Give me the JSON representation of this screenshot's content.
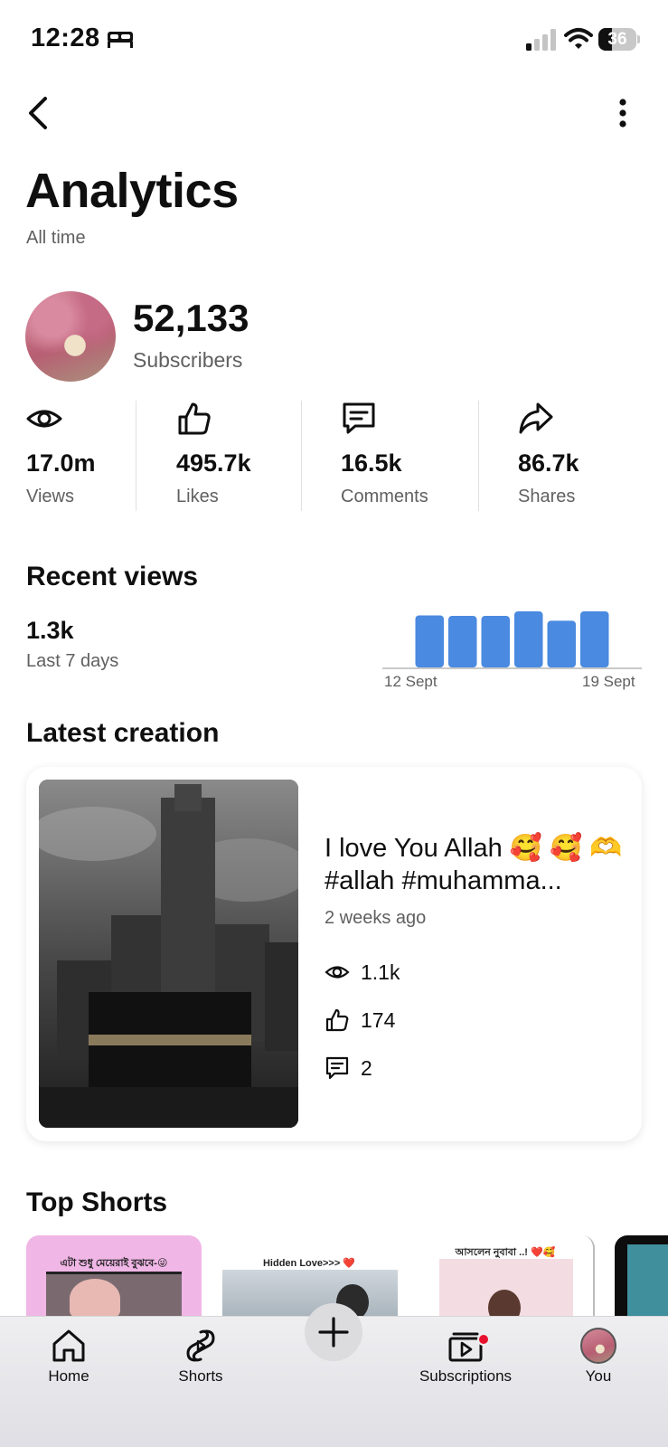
{
  "status_bar": {
    "time": "12:28",
    "battery": "36",
    "battery_level": 0.36
  },
  "header": {
    "title": "Analytics",
    "subtitle": "All time"
  },
  "channel": {
    "subscribers_count": "52,133",
    "subscribers_label": "Subscribers"
  },
  "stats": [
    {
      "icon": "eye-icon",
      "value": "17.0m",
      "label": "Views"
    },
    {
      "icon": "thumbs-up-icon",
      "value": "495.7k",
      "label": "Likes"
    },
    {
      "icon": "comment-icon",
      "value": "16.5k",
      "label": "Comments"
    },
    {
      "icon": "share-icon",
      "value": "86.7k",
      "label": "Shares"
    }
  ],
  "recent_views": {
    "title": "Recent views",
    "value": "1.3k",
    "period_label": "Last 7 days",
    "chart_data": {
      "type": "bar",
      "categories": [
        "12 Sept",
        "",
        "",
        "",
        "",
        "",
        "",
        "19 Sept"
      ],
      "values": [
        0,
        205,
        203,
        203,
        221,
        184,
        221,
        0
      ],
      "start_label": "12 Sept",
      "end_label": "19 Sept",
      "bar_color": "#4a8ae0"
    }
  },
  "latest_creation": {
    "title_label": "Latest creation",
    "video_title": "I love You Allah 🥰 🥰 🫶 #allah #muhamma...",
    "age": "2 weeks ago",
    "views": "1.1k",
    "likes": "174",
    "comments": "2"
  },
  "top_shorts": {
    "title": "Top Shorts",
    "captions": [
      "এটা শুধু মেয়েরাই বুঝবে-😜",
      "Hidden Love>>> ❤️",
      "আসলেন নুবাবা ..! ❤️🥰",
      ""
    ]
  },
  "bottom_nav": [
    {
      "icon": "home-icon",
      "label": "Home"
    },
    {
      "icon": "shorts-icon",
      "label": "Shorts"
    },
    {
      "icon": "plus-icon",
      "label": ""
    },
    {
      "icon": "subscriptions-icon",
      "label": "Subscriptions"
    },
    {
      "icon": "avatar",
      "label": "You"
    }
  ]
}
